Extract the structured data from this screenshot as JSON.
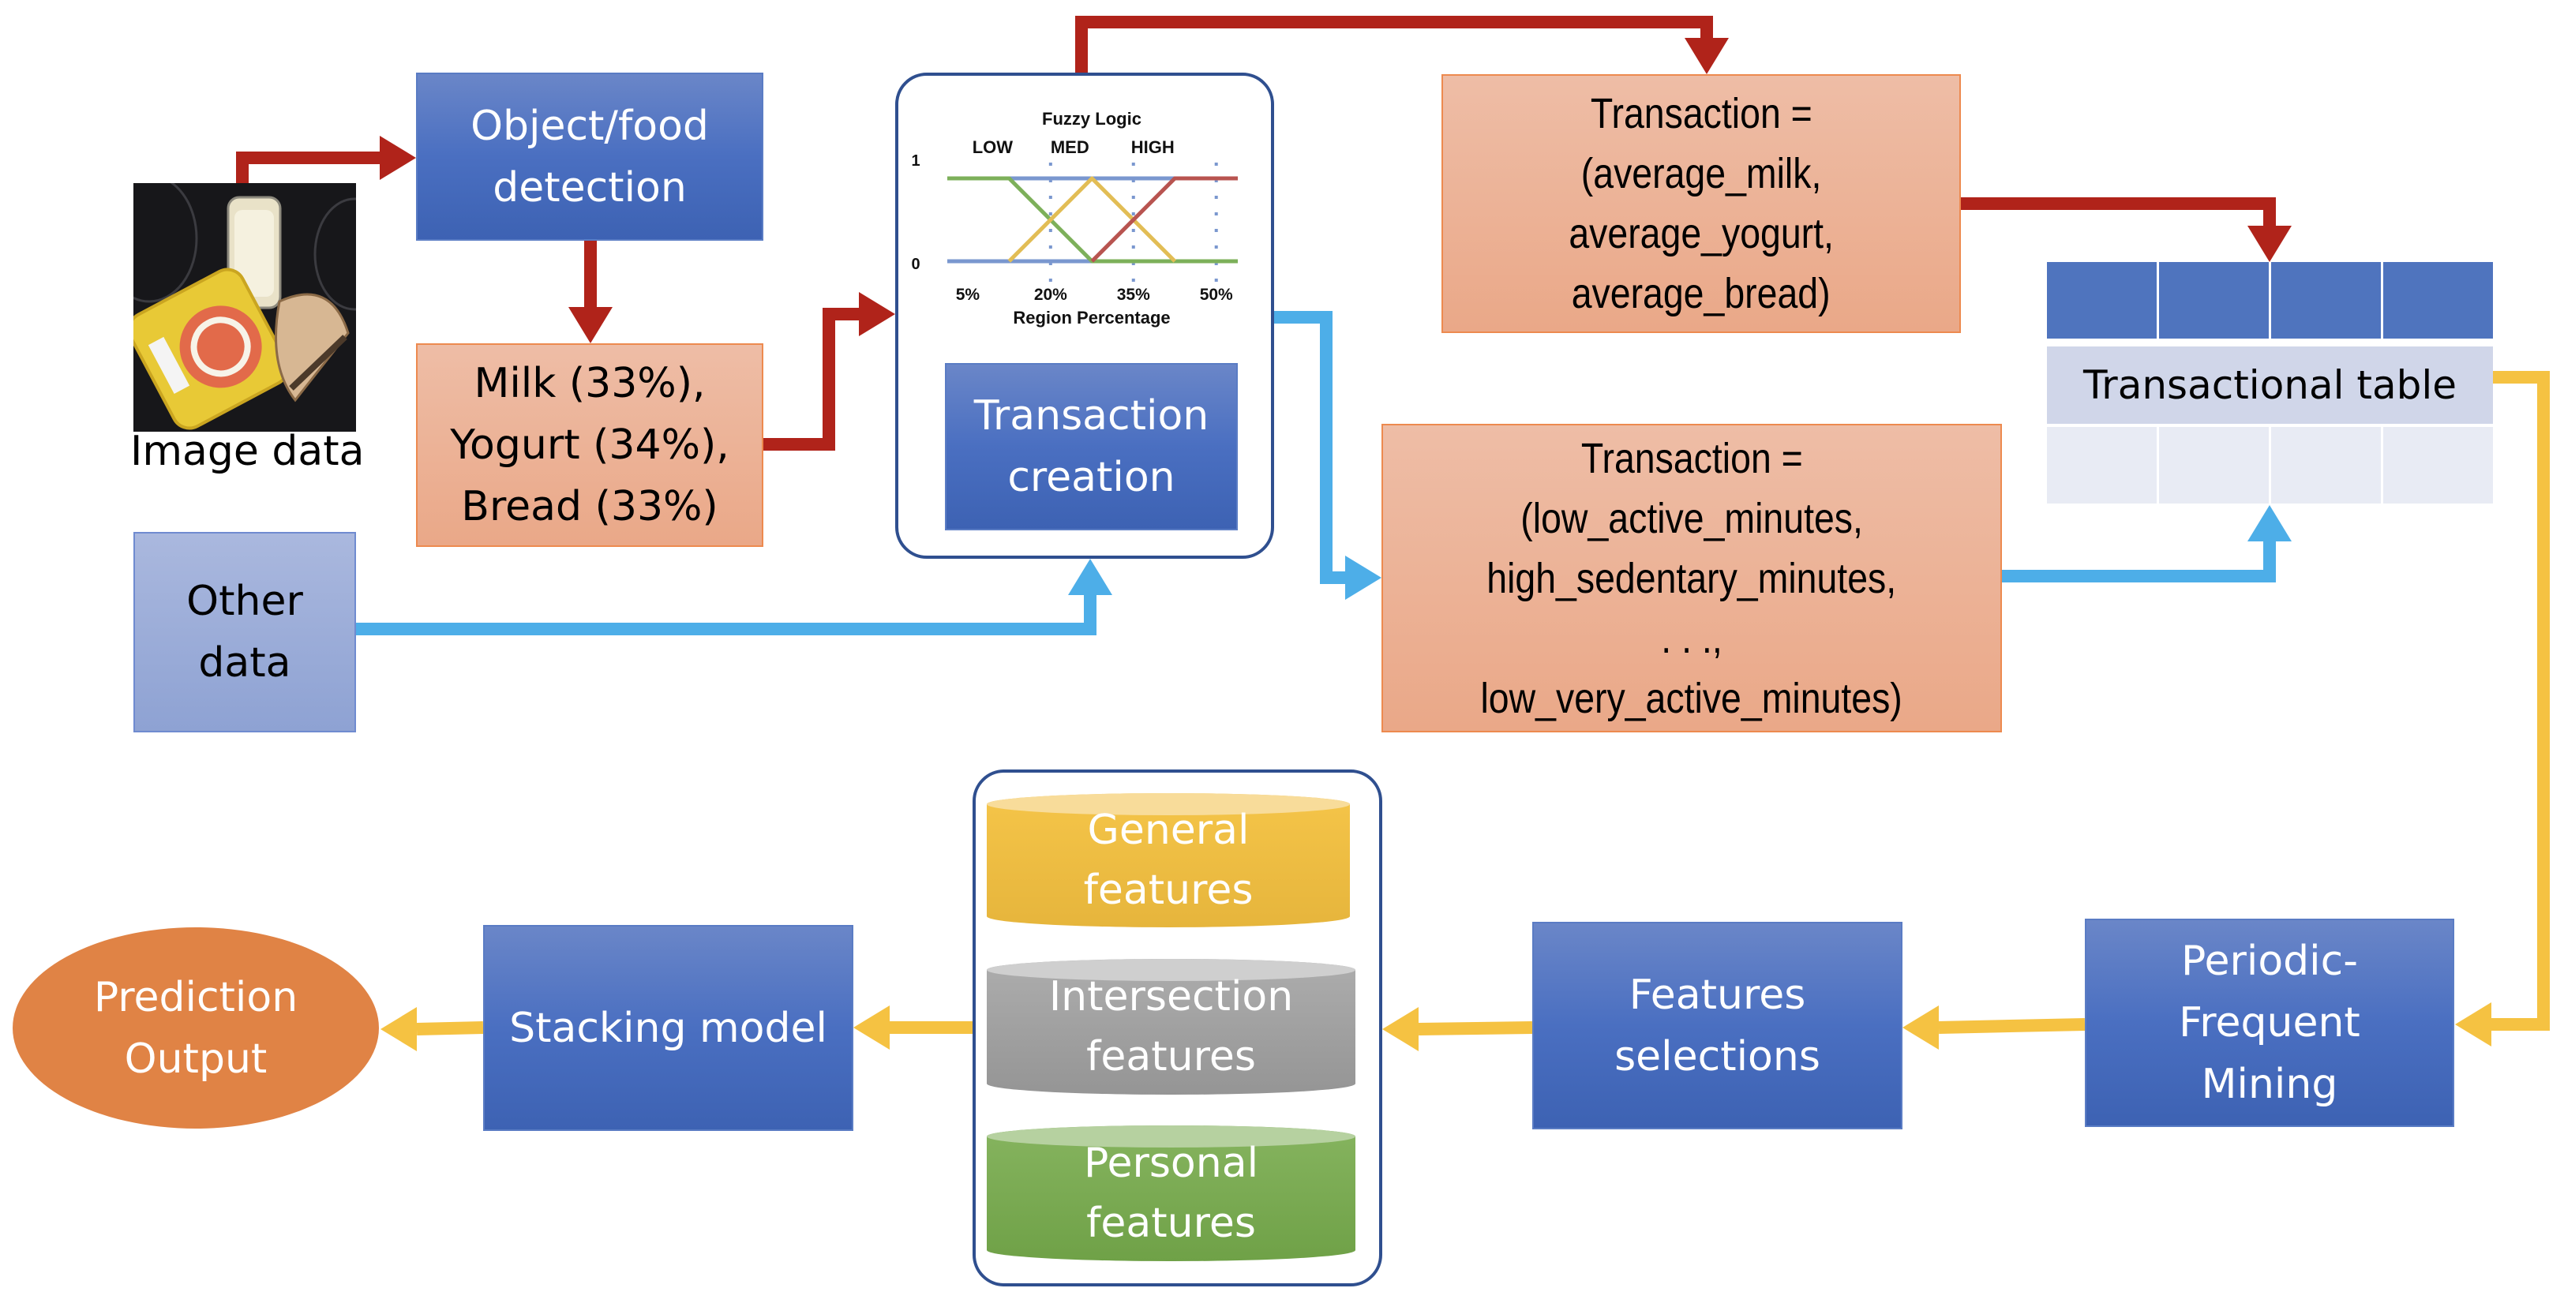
{
  "diagram": {
    "image_data_label": "Image data",
    "object_detection": [
      "Object/food",
      "detection"
    ],
    "detected_items": [
      "Milk (33%),",
      "Yogurt (34%),",
      "Bread (33%)"
    ],
    "other_data": [
      "Other",
      "data"
    ],
    "transaction_creation": [
      "Transaction",
      "creation"
    ],
    "transaction_food": [
      "Transaction =",
      "(average_milk,",
      "average_yogurt,",
      "average_bread)"
    ],
    "transaction_activity": [
      "Transaction =",
      "(low_active_minutes,",
      "high_sedentary_minutes,",
      ". . .,",
      "low_very_active_minutes)"
    ],
    "transactional_table": "Transactional table",
    "periodic_frequent_mining": [
      "Periodic-",
      "Frequent",
      "Mining"
    ],
    "features_selections": [
      "Features",
      "selections"
    ],
    "feature_sets": [
      {
        "lines": [
          "General",
          "features"
        ],
        "color": "#f5c242"
      },
      {
        "lines": [
          "Intersection",
          "features"
        ],
        "color": "#a5a5a5"
      },
      {
        "lines": [
          "Personal",
          "features"
        ],
        "color": "#7aab52"
      }
    ],
    "stacking_model": "Stacking model",
    "prediction_output": [
      "Prediction",
      "Output"
    ],
    "colors": {
      "image_flow": "#b0231a",
      "other_data_flow": "#4daee8",
      "mining_flow": "#f5c242",
      "process_box": "#4a6fc1",
      "data_box": "#ebb298",
      "output": "#e08345"
    }
  },
  "chart_data": {
    "type": "line",
    "title": "Fuzzy Logic",
    "xlabel": "Region Percentage",
    "ylabel": "",
    "x_ticks": [
      "5%",
      "20%",
      "35%",
      "50%"
    ],
    "y_ticks": [
      "0",
      "1"
    ],
    "xlim": [
      1.3,
      53.9
    ],
    "ylim": [
      0,
      1
    ],
    "membership_labels": [
      "LOW",
      "MED",
      "HIGH"
    ],
    "series": [
      {
        "name": "LOW",
        "color": "#7db05a",
        "points": [
          [
            1.3,
            1
          ],
          [
            12.5,
            1
          ],
          [
            27.5,
            0
          ],
          [
            53.9,
            0
          ]
        ]
      },
      {
        "name": "MED",
        "color": "#e2bd55",
        "points": [
          [
            12.5,
            0
          ],
          [
            27.5,
            1
          ],
          [
            42.5,
            0
          ]
        ]
      },
      {
        "name": "HIGH",
        "color": "#b85450",
        "points": [
          [
            27.5,
            0
          ],
          [
            42.5,
            1
          ],
          [
            53.9,
            1
          ]
        ]
      }
    ],
    "baseline_color": "#7a97cf",
    "gridlines_dotted_at": [
      20,
      35,
      50
    ]
  }
}
